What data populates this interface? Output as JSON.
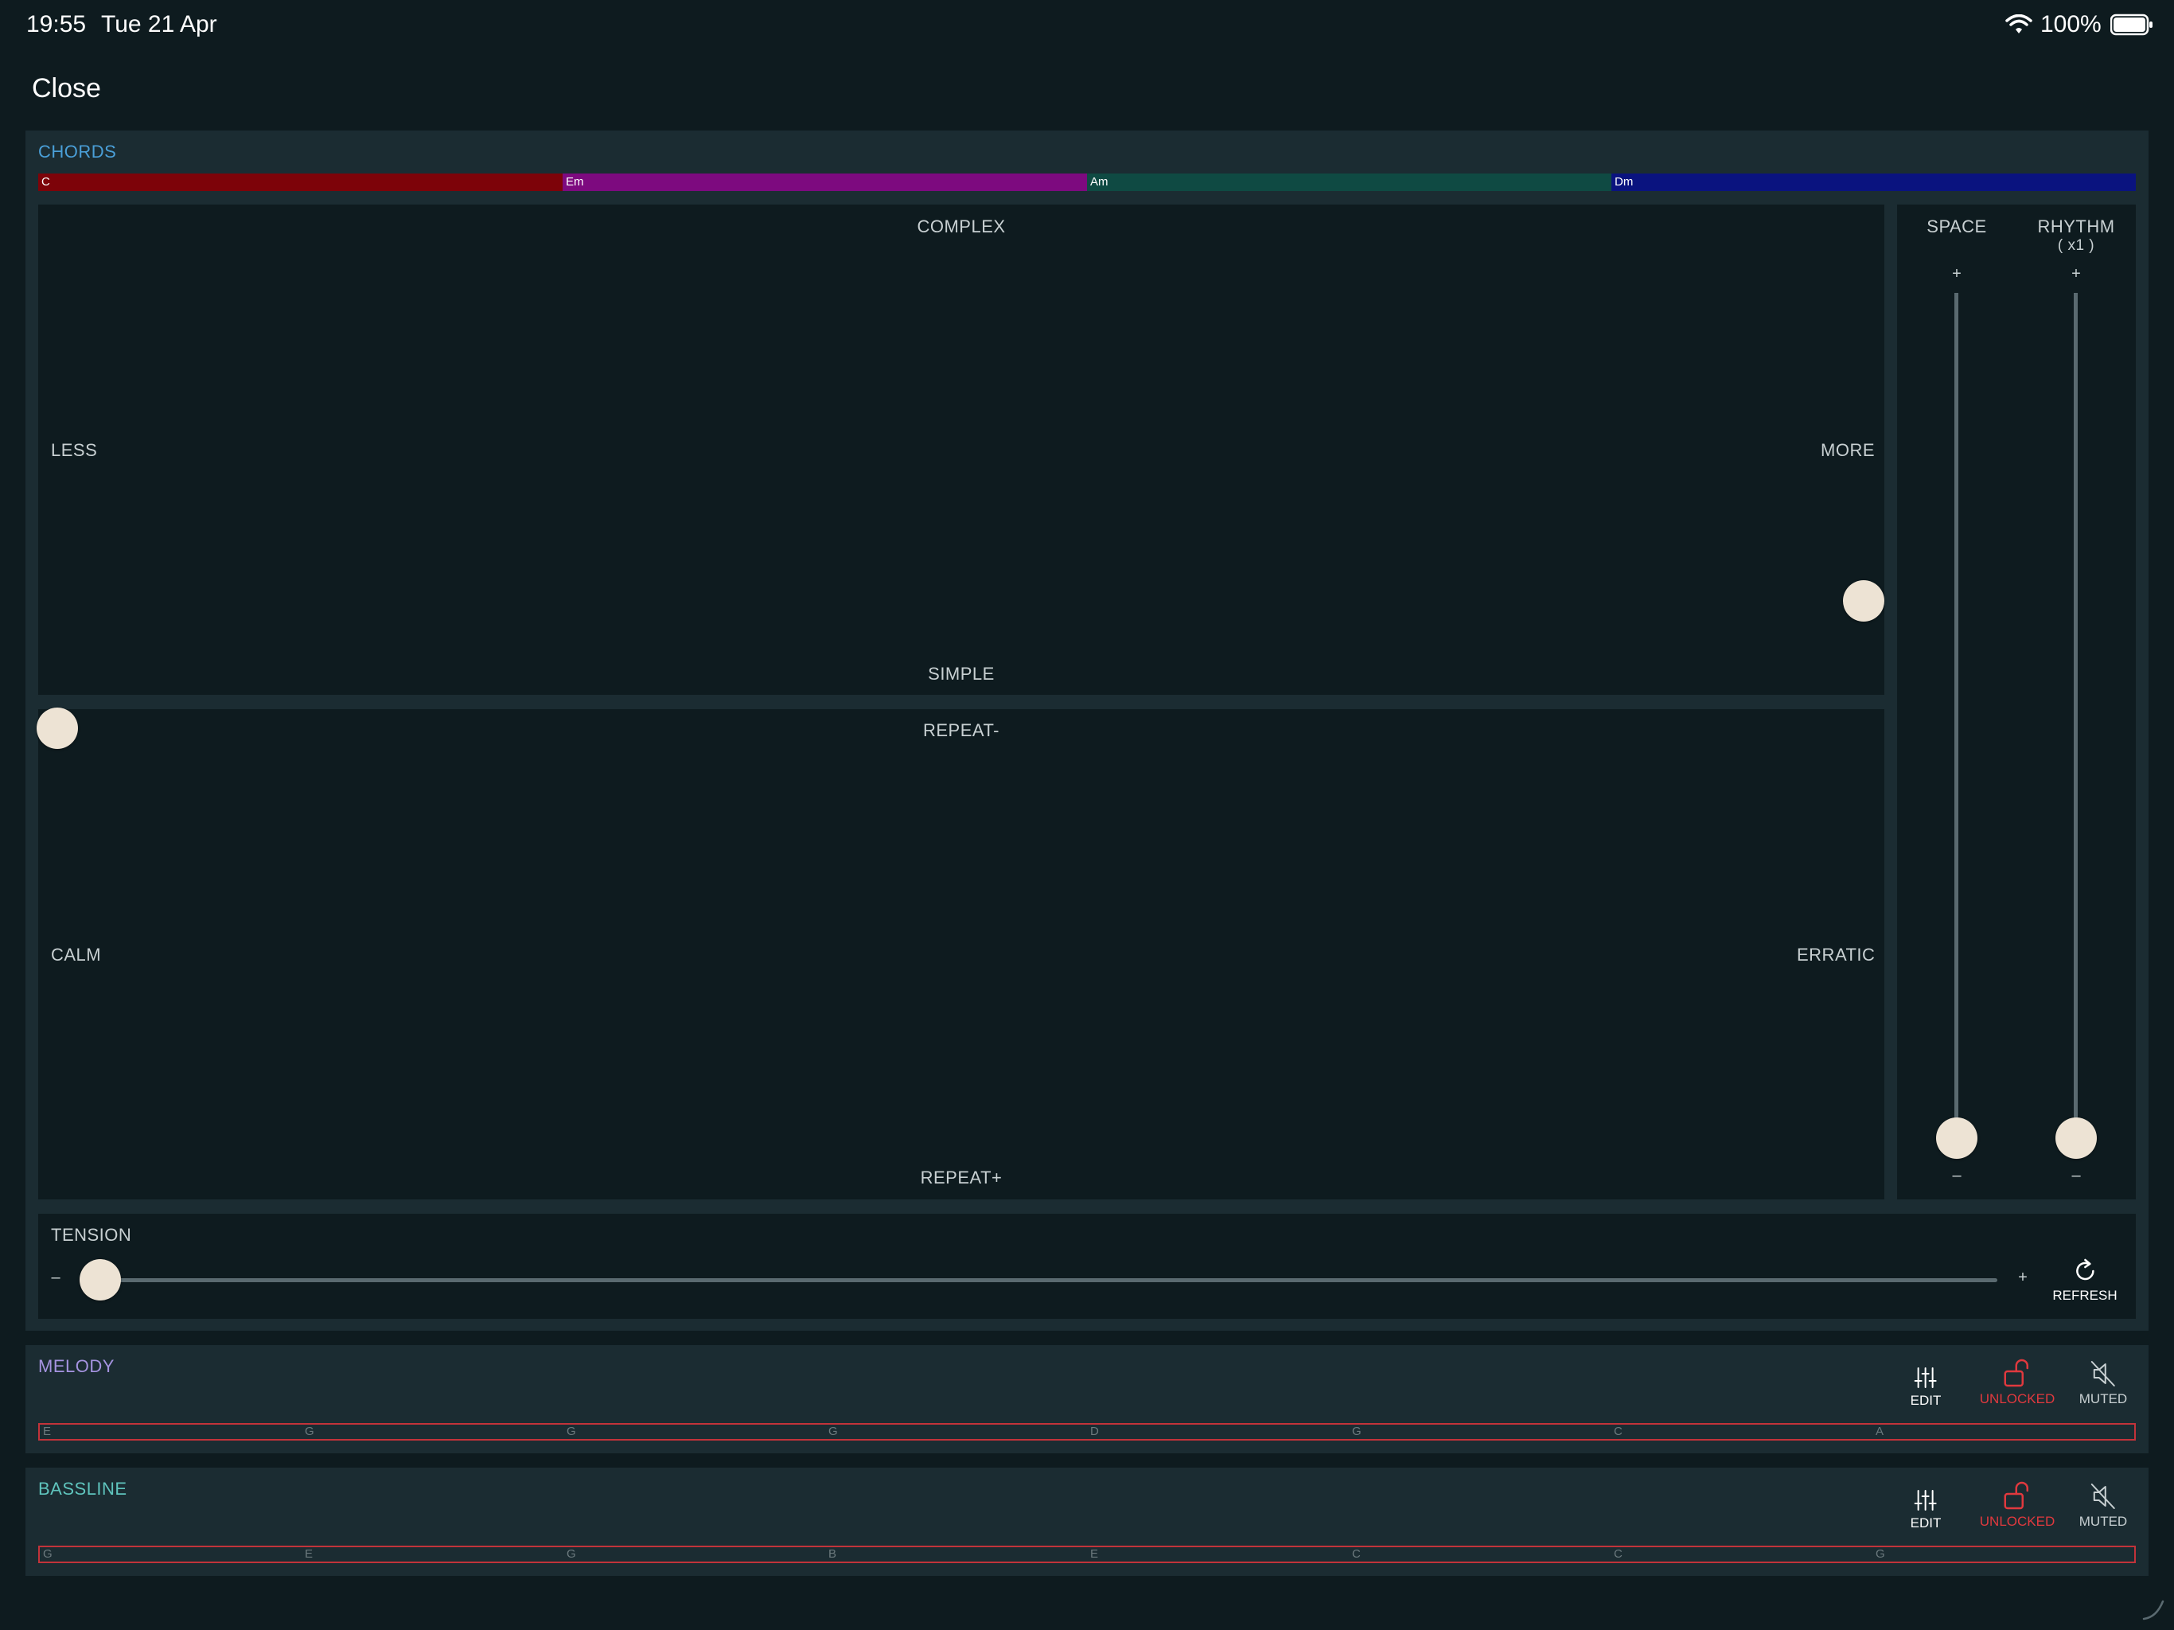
{
  "status": {
    "time": "19:55",
    "date": "Tue 21 Apr",
    "battery": "100%"
  },
  "nav": {
    "close_label": "Close"
  },
  "chords": {
    "title": "CHORDS",
    "items": [
      {
        "label": "C",
        "color": "#7d0309"
      },
      {
        "label": "Em",
        "color": "#7d0a7f"
      },
      {
        "label": "Am",
        "color": "#0f4a43"
      },
      {
        "label": "Dm",
        "color": "#0a137f"
      }
    ]
  },
  "pad_complexity": {
    "top": "COMPLEX",
    "bottom": "SIMPLE",
    "left": "LESS",
    "right": "MORE",
    "x": 1.0,
    "y": 0.24
  },
  "pad_variation": {
    "top": "REPEAT-",
    "bottom": "REPEAT+",
    "left": "CALM",
    "right": "ERRATIC",
    "x": 0.0,
    "y": 1.0
  },
  "space": {
    "label": "SPACE",
    "plus": "+",
    "minus": "–",
    "value": 0
  },
  "rhythm": {
    "label": "RHYTHM",
    "sub": "( x1 )",
    "plus": "+",
    "minus": "–",
    "value": 0
  },
  "tension": {
    "label": "TENSION",
    "minus": "–",
    "plus": "+",
    "value": 0,
    "refresh_label": "REFRESH"
  },
  "melody": {
    "title": "MELODY",
    "title_color": "#a593e0",
    "edit_label": "EDIT",
    "lock_label": "UNLOCKED",
    "mute_label": "MUTED",
    "notes": [
      "E",
      "G",
      "G",
      "G",
      "D",
      "G",
      "C",
      "A"
    ]
  },
  "bassline": {
    "title": "BASSLINE",
    "title_color": "#5fc4bd",
    "edit_label": "EDIT",
    "lock_label": "UNLOCKED",
    "mute_label": "MUTED",
    "notes": [
      "G",
      "E",
      "G",
      "B",
      "E",
      "C",
      "C",
      "G"
    ]
  },
  "colors": {
    "accent_blue": "#4a9fd8",
    "unlocked_red": "#e0393e",
    "knob": "#ede3d4"
  }
}
